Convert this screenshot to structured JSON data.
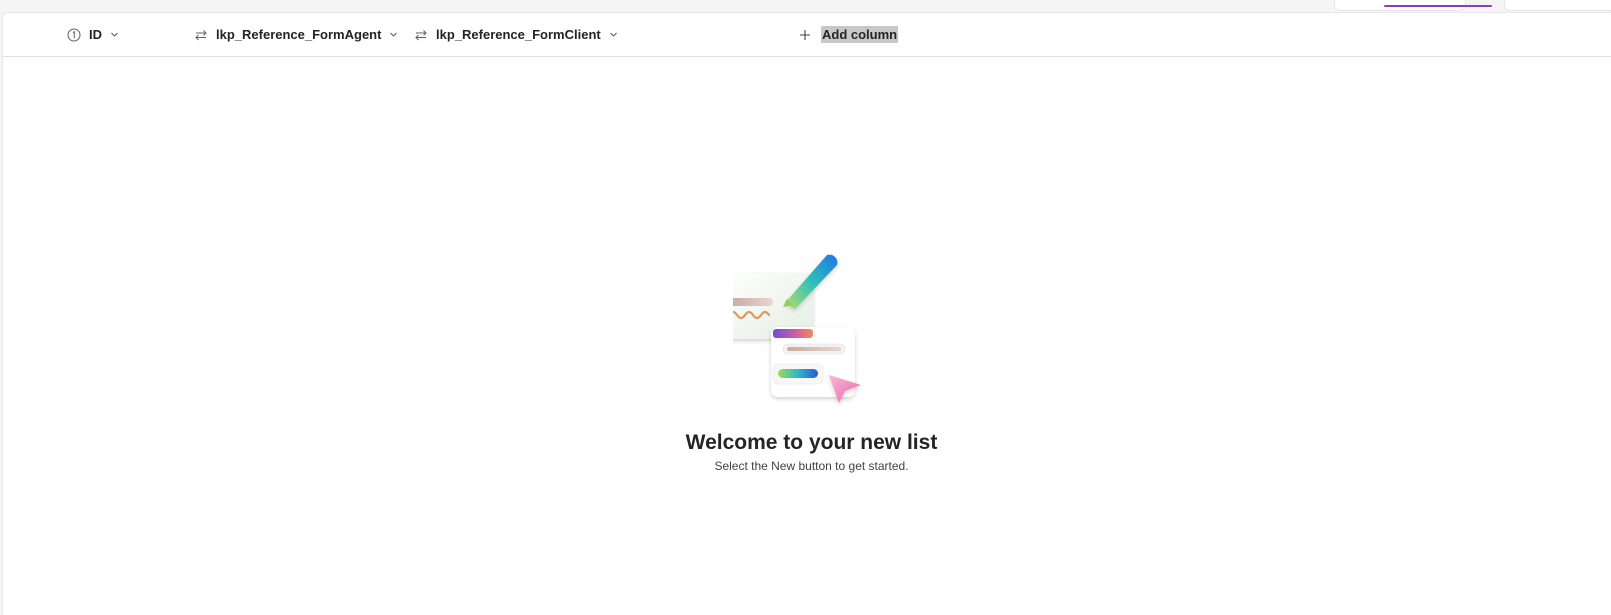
{
  "columns": [
    {
      "label": "ID",
      "icon": "number-icon"
    },
    {
      "label": "lkp_Reference_FormAgent",
      "icon": "lookup-icon"
    },
    {
      "label": "lkp_Reference_FormClient",
      "icon": "lookup-icon"
    }
  ],
  "add_column": {
    "label": "Add column",
    "icon": "plus-icon"
  },
  "empty_state": {
    "title": "Welcome to your new list",
    "subtitle": "Select the New button to get started."
  },
  "colors": {
    "accent": "#8a3fb5",
    "text": "#242424",
    "border": "#e1e1e1",
    "highlight": "#c8c8c8"
  }
}
